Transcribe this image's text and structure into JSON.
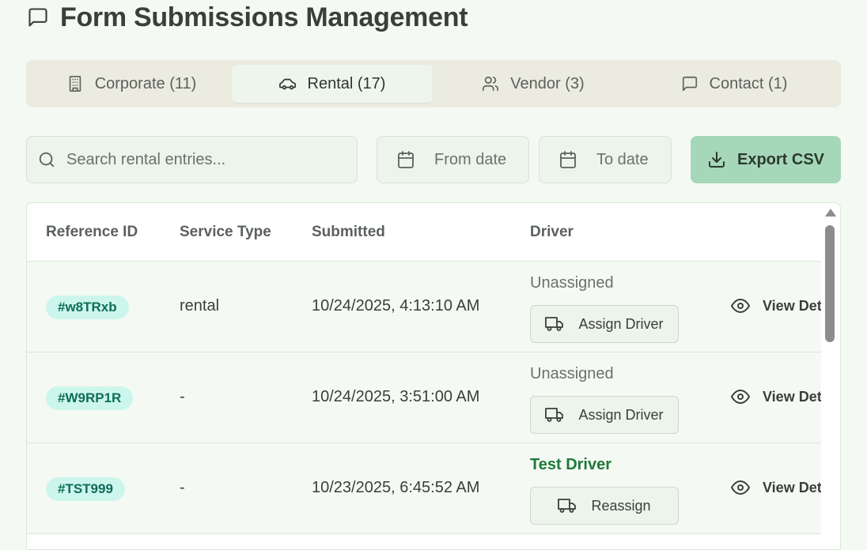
{
  "header": {
    "title": "Form Submissions Management",
    "icon": "message-square-icon"
  },
  "tabs": [
    {
      "label": "Corporate (11)",
      "icon": "building-icon",
      "active": false
    },
    {
      "label": "Rental (17)",
      "icon": "car-icon",
      "active": true
    },
    {
      "label": "Vendor (3)",
      "icon": "users-icon",
      "active": false
    },
    {
      "label": "Contact (1)",
      "icon": "message-square-icon",
      "active": false
    }
  ],
  "toolbar": {
    "search_placeholder": "Search rental entries...",
    "from_date": "From date",
    "to_date": "To date",
    "export_label": "Export CSV"
  },
  "table": {
    "columns": [
      "Reference ID",
      "Service Type",
      "Submitted",
      "Driver"
    ],
    "rows": [
      {
        "ref": "#w8TRxb",
        "service": "rental",
        "submitted": "10/24/2025, 4:13:10 AM",
        "driver": "Unassigned",
        "driver_assigned": false,
        "action": "Assign Driver",
        "view": "View Details"
      },
      {
        "ref": "#W9RP1R",
        "service": "-",
        "submitted": "10/24/2025, 3:51:00 AM",
        "driver": "Unassigned",
        "driver_assigned": false,
        "action": "Assign Driver",
        "view": "View Details"
      },
      {
        "ref": "#TST999",
        "service": "-",
        "submitted": "10/23/2025, 6:45:52 AM",
        "driver": "Test Driver",
        "driver_assigned": true,
        "action": "Reassign",
        "view": "View Details"
      }
    ]
  },
  "colors": {
    "accent": "#a6d7b8",
    "badge_bg": "#ccf6ec",
    "badge_text": "#0f6d59",
    "assigned_driver": "#1e7a3a"
  }
}
